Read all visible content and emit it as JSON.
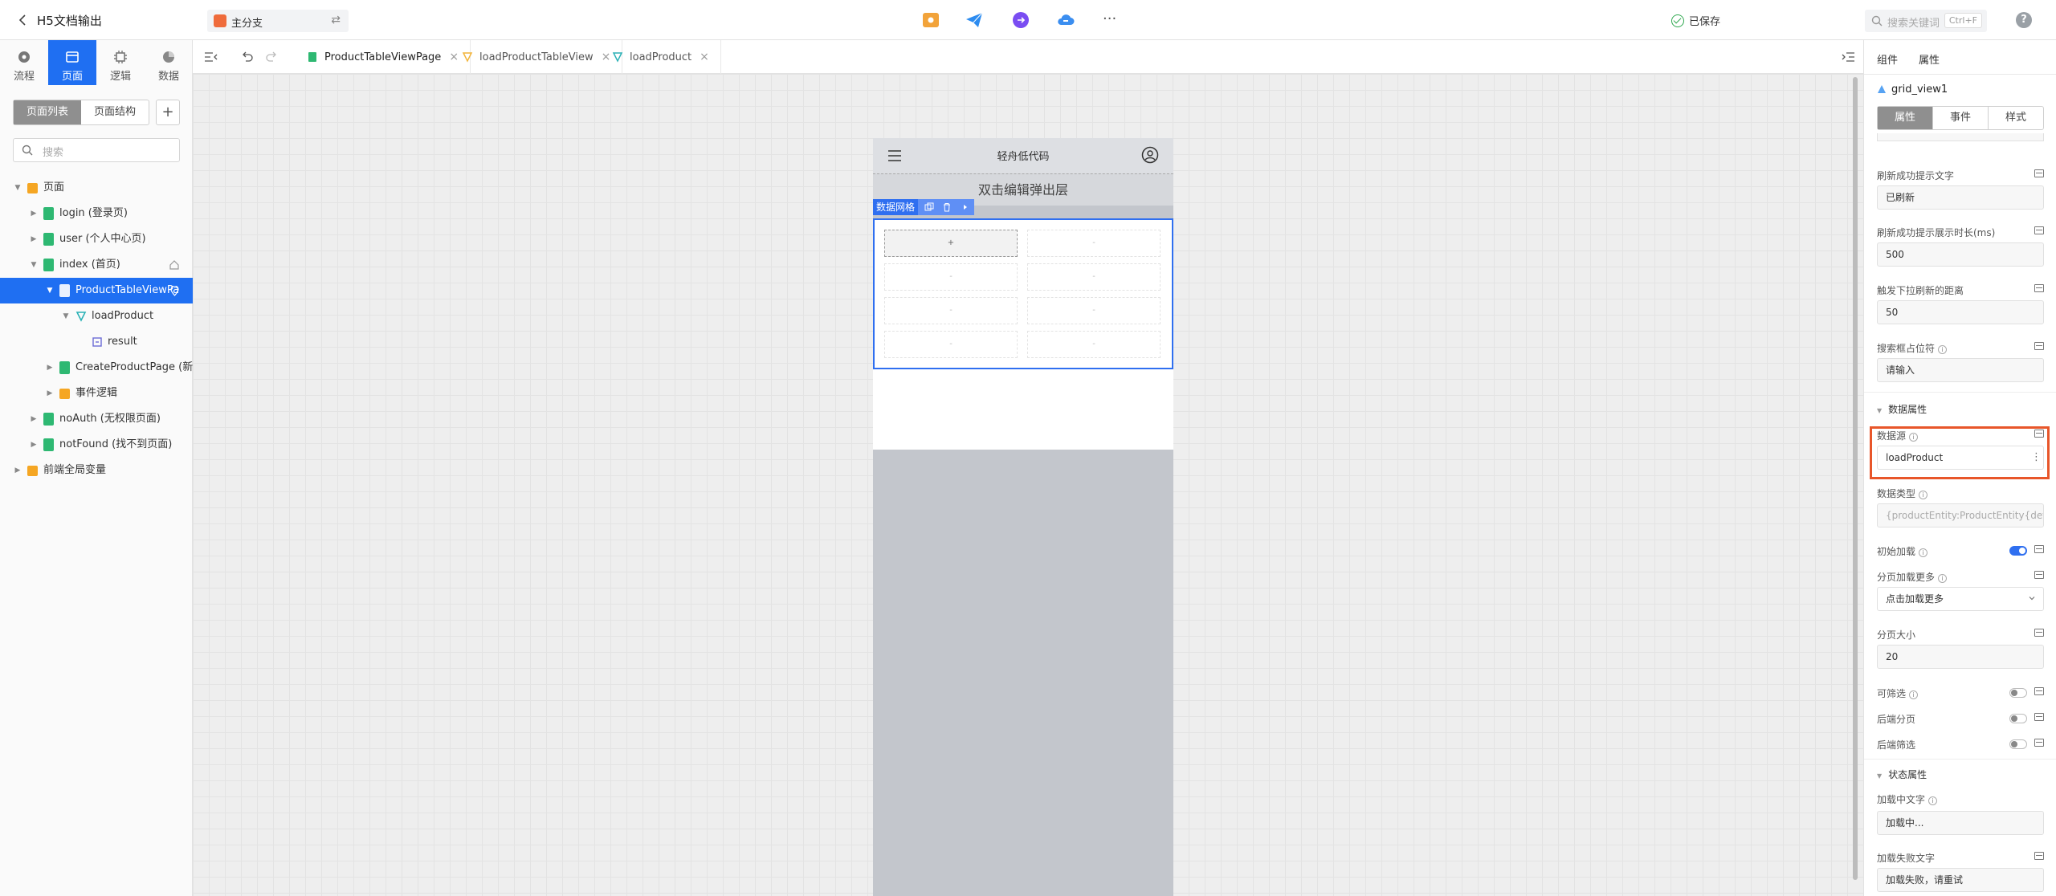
{
  "topbar": {
    "title": "H5文档输出",
    "branch": "主分支",
    "saved": "已保存",
    "search_placeholder": "搜索关键词",
    "search_shortcut": "Ctrl+F",
    "help": "?",
    "more": "···"
  },
  "left": {
    "nav_tabs": [
      {
        "label": "流程",
        "icon": "flow-icon"
      },
      {
        "label": "页面",
        "icon": "page-icon"
      },
      {
        "label": "逻辑",
        "icon": "chip-icon"
      },
      {
        "label": "数据",
        "icon": "pie-icon"
      }
    ],
    "seg": [
      "页面列表",
      "页面结构"
    ],
    "add": "+",
    "search_placeholder": "搜索",
    "tree": [
      {
        "label": "页面"
      },
      {
        "label": "login (登录页)"
      },
      {
        "label": "user (个人中心页)"
      },
      {
        "label": "index (首页)"
      },
      {
        "label": "ProductTableViewPa"
      },
      {
        "label": "loadProduct"
      },
      {
        "label": "result"
      },
      {
        "label": "CreateProductPage (新增"
      },
      {
        "label": "事件逻辑"
      },
      {
        "label": "noAuth (无权限页面)"
      },
      {
        "label": "notFound (找不到页面)"
      },
      {
        "label": "前端全局变量"
      }
    ]
  },
  "tabs": [
    {
      "label": "ProductTableViewPage"
    },
    {
      "label": "loadProductTableView"
    },
    {
      "label": "loadProduct"
    }
  ],
  "phone": {
    "title": "轻舟低代码",
    "popup_hint": "双击编辑弹出层",
    "grid_label": "数据网格",
    "add_cell": "+",
    "cell_dash": "-"
  },
  "right": {
    "tabs": [
      "组件",
      "属性"
    ],
    "component_name": "grid_view1",
    "seg": [
      "属性",
      "事件",
      "样式"
    ],
    "props": {
      "refresh_text_label": "刷新成功提示文字",
      "refresh_text_value": "已刷新",
      "refresh_duration_label": "刷新成功提示展示时长(ms)",
      "refresh_duration_value": "500",
      "pull_distance_label": "触发下拉刷新的距离",
      "pull_distance_value": "50",
      "search_placeholder_label": "搜索框占位符",
      "search_placeholder_value": "请输入",
      "data_section": "数据属性",
      "datasource_label": "数据源",
      "datasource_value": "loadProduct",
      "datatype_label": "数据类型",
      "datatype_value": "{productEntity:ProductEntity{defa",
      "initial_load_label": "初始加载",
      "load_more_label": "分页加载更多",
      "load_more_value": "点击加载更多",
      "page_size_label": "分页大小",
      "page_size_value": "20",
      "filterable_label": "可筛选",
      "backend_paging_label": "后端分页",
      "backend_filter_label": "后端筛选",
      "status_section": "状态属性",
      "loading_text_label": "加载中文字",
      "loading_text_value": "加载中...",
      "error_text_label": "加载失败文字",
      "error_text_value": "加载失败，请重试"
    },
    "toggles": {
      "initial_load": true,
      "filterable": false,
      "backend_paging": false,
      "backend_filter": false
    }
  },
  "colors": {
    "accent": "#1f6ff2",
    "highlight": "#e8562a",
    "saved": "#2fa84f"
  }
}
